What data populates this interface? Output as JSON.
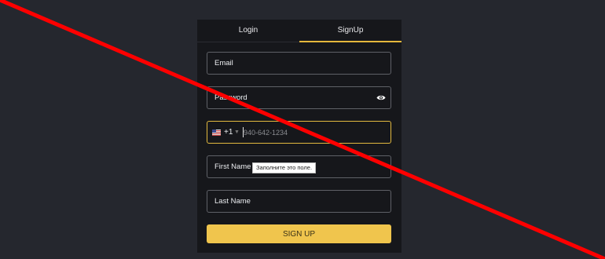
{
  "tabs": {
    "login": "Login",
    "signup": "SignUp"
  },
  "form": {
    "email_label": "Email",
    "password_label": "Password",
    "phone_country_code": "+1",
    "phone_placeholder": "940-642-1234",
    "first_name_label": "First Name",
    "last_name_label": "Last Name",
    "submit_label": "SIGN UP"
  },
  "tooltip": {
    "text": "Заполните это поле."
  },
  "icons": {
    "password_toggle": "eye-icon",
    "country_flag": "us-flag-icon",
    "country_dropdown": "chevron-down-icon"
  },
  "colors": {
    "accent": "#f0c54d",
    "focus_border": "#e2b93f",
    "overlay_line": "#ff0000"
  }
}
